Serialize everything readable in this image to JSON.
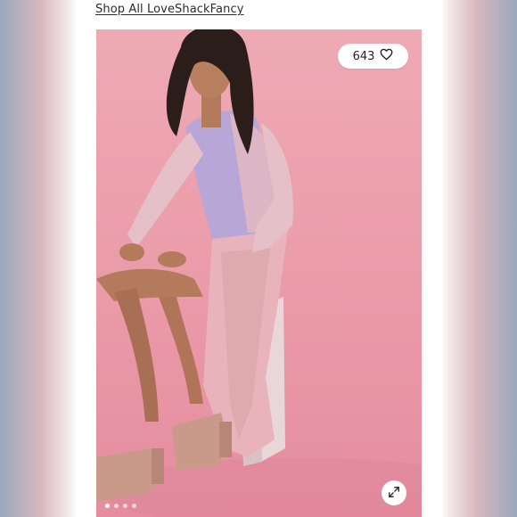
{
  "header": {
    "shop_link": "Shop All LoveShackFancy"
  },
  "listing": {
    "like_count": "643",
    "carousel": {
      "total": 4,
      "active": 1
    }
  },
  "icons": {
    "like": "heart-outline-icon",
    "expand": "expand-arrows-icon"
  },
  "colors": {
    "backdrop": "#ea9aa8",
    "dress_lavender": "#b8a6d6",
    "dress_pink": "#e9b3bb"
  }
}
